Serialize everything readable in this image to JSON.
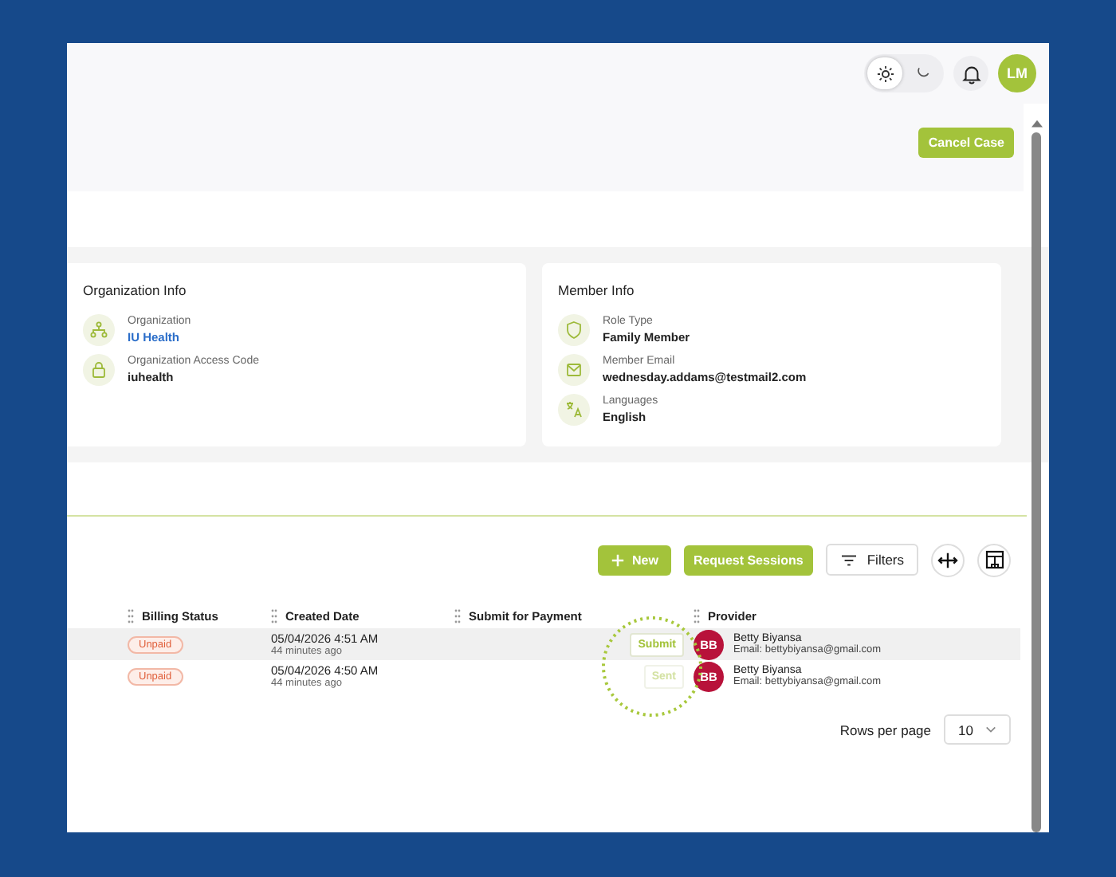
{
  "header": {
    "theme_toggle": [
      {
        "kind": "sun",
        "selected": true
      },
      {
        "kind": "moon",
        "selected": false
      }
    ],
    "avatar": "LM"
  },
  "cancel_button": "Cancel Case",
  "cards": [
    {
      "title": "Organization Info",
      "fields": [
        {
          "kind": "org",
          "label": "Organization",
          "value": "IU Health",
          "link": true
        },
        {
          "kind": "lock",
          "label": "Organization Access Code",
          "value": "iuhealth",
          "link": false
        }
      ]
    },
    {
      "title": "Member Info",
      "fields": [
        {
          "kind": "role",
          "label": "Role Type",
          "value": "Family Member",
          "link": false
        },
        {
          "kind": "mail",
          "label": "Member Email",
          "value": "wednesday.addams@testmail2.com",
          "link": false
        },
        {
          "kind": "lang",
          "label": "Languages",
          "value": "English",
          "link": false
        }
      ]
    }
  ],
  "toolbar": {
    "new_button": "New",
    "request_button": "Request Sessions",
    "filters_button": "Filters"
  },
  "table": {
    "columns": [
      "Billing Status",
      "Created Date",
      "Submit for Payment",
      "Provider"
    ],
    "rows": [
      {
        "billing_status": "Unpaid",
        "created_date": "05/04/2026 4:51 AM",
        "created_ago": "44 minutes ago",
        "submit": {
          "label": "Submit",
          "disabled": false
        },
        "provider_initials": "BB",
        "provider_name": "Betty Biyansa",
        "provider_email": "Email: bettybiyansa@gmail.com",
        "selected": true
      },
      {
        "billing_status": "Unpaid",
        "created_date": "05/04/2026 4:50 AM",
        "created_ago": "44 minutes ago",
        "submit": {
          "label": "Sent",
          "disabled": true
        },
        "provider_initials": "BB",
        "provider_name": "Betty Biyansa",
        "provider_email": "Email: bettybiyansa@gmail.com",
        "selected": false
      }
    ]
  },
  "pagination": {
    "label": "Rows per page",
    "value": "10"
  }
}
